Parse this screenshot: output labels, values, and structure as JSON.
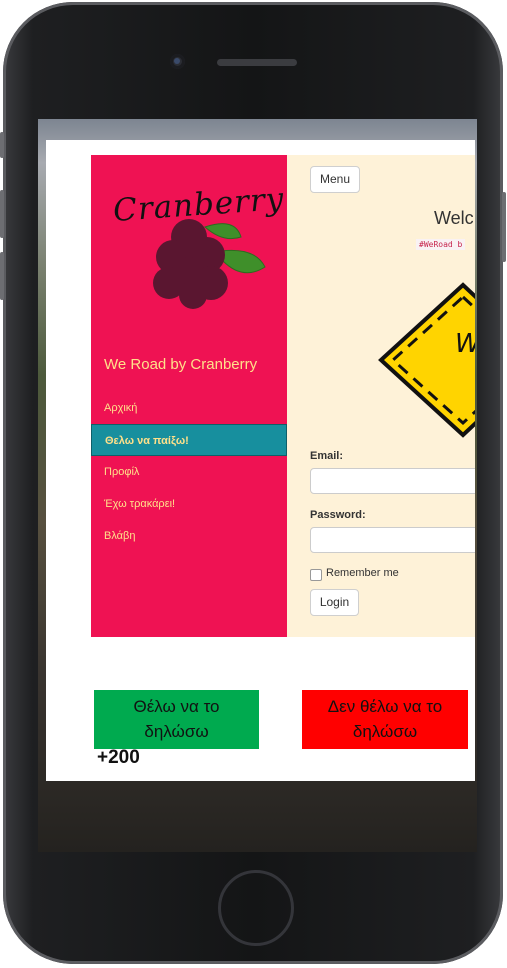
{
  "sidebar": {
    "logo_text": "Cranberry",
    "brand": "We Road by Cranberry",
    "items": [
      {
        "label": "Αρχική"
      },
      {
        "label": "Θελω να παίξω!"
      },
      {
        "label": "Προφίλ"
      },
      {
        "label": "Έχω τρακάρει!"
      },
      {
        "label": "Βλάβη"
      }
    ]
  },
  "main": {
    "menu_button": "Menu",
    "welcome": "Welc",
    "tag": "#WeRoad  b",
    "sign_text": "W  ro",
    "email_label": "Email:",
    "password_label": "Password:",
    "remember_label": "Remember me",
    "login_button": "Login"
  },
  "actions": {
    "yes_label": "Θέλω να το δηλώσω",
    "no_label": "Δεν θέλω να το δηλώσω",
    "score": "+200"
  },
  "colors": {
    "sidebar": "#ef1253",
    "active_item": "#178f9e",
    "nav_text": "#ffe08a",
    "content_bg": "#fef2d8",
    "yes_button": "#00aa4f",
    "no_button": "#ff0000"
  }
}
